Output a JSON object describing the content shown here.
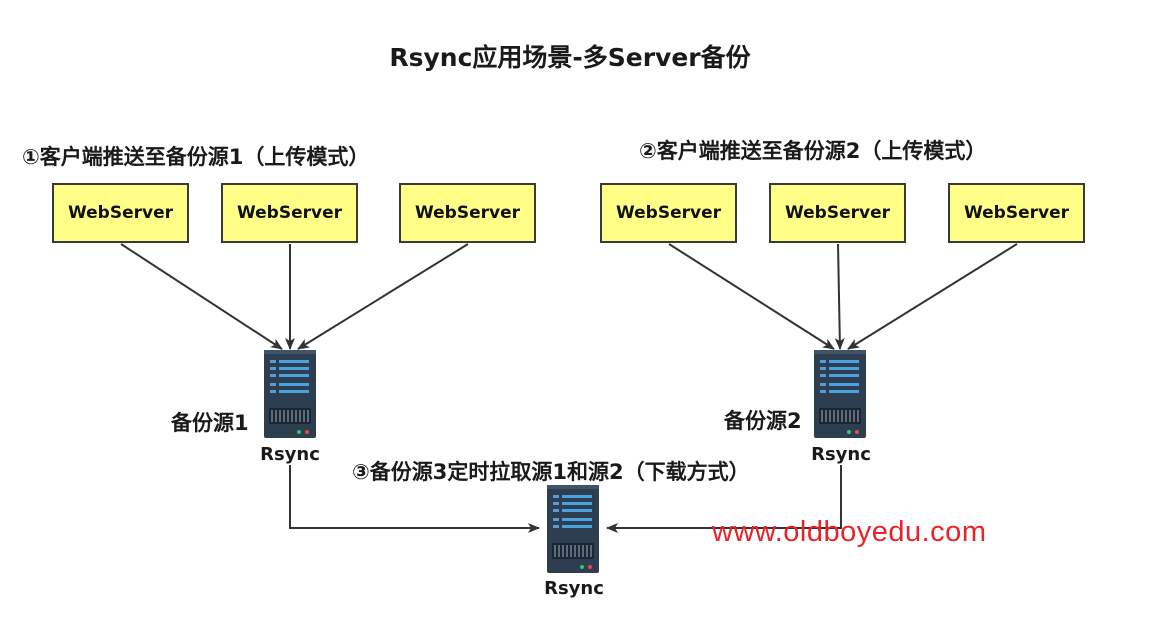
{
  "title": "Rsync应用场景-多Server备份",
  "section1": "①客户端推送至备份源1（上传模式）",
  "section2": "②客户端推送至备份源2（上传模式）",
  "section3": "③备份源3定时拉取源1和源2（下载方式）",
  "webservers_group1": [
    "WebServer",
    "WebServer",
    "WebServer"
  ],
  "webservers_group2": [
    "WebServer",
    "WebServer",
    "WebServer"
  ],
  "backup1_label": "备份源1",
  "backup2_label": "备份源2",
  "server1_caption": "Rsync",
  "server2_caption": "Rsync",
  "server3_caption": "Rsync",
  "watermark": "www.oldboyedu.com",
  "colors": {
    "webserver_fill": "#ffff88",
    "server_body": "#2d3e50",
    "watermark": "#e8242a"
  },
  "icons": [
    "server-rack-icon"
  ]
}
